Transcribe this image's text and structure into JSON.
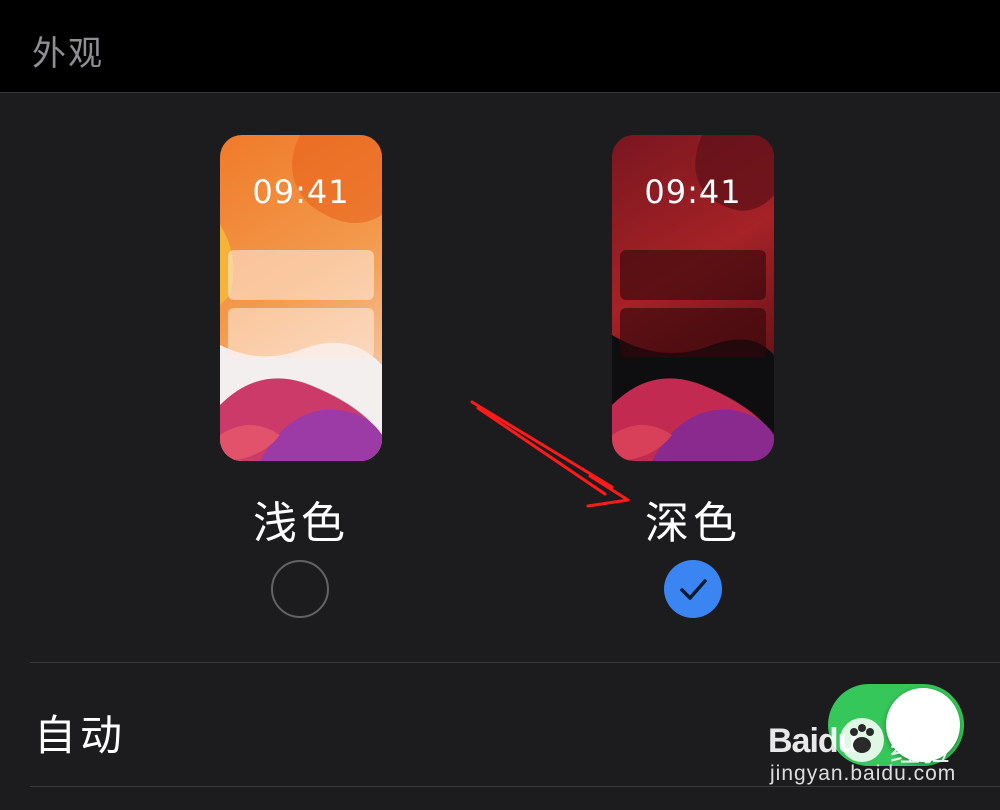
{
  "header": {
    "title": "外观"
  },
  "appearance": {
    "options": [
      {
        "label": "浅色",
        "preview_time": "09:41",
        "selected": false
      },
      {
        "label": "深色",
        "preview_time": "09:41",
        "selected": true
      }
    ]
  },
  "auto": {
    "label": "自动",
    "enabled": true
  },
  "watermark": {
    "brand": "Baidu",
    "sub": "经验",
    "url": "jingyan.baidu.com"
  },
  "colors": {
    "accent_blue": "#3a85f2",
    "toggle_green": "#35c759",
    "annotation_red": "#ff1a1a",
    "panel_bg": "#1c1c1e"
  },
  "icons": {
    "selected_radio": "checkmark-icon",
    "annotation": "red-arrow-icon"
  }
}
